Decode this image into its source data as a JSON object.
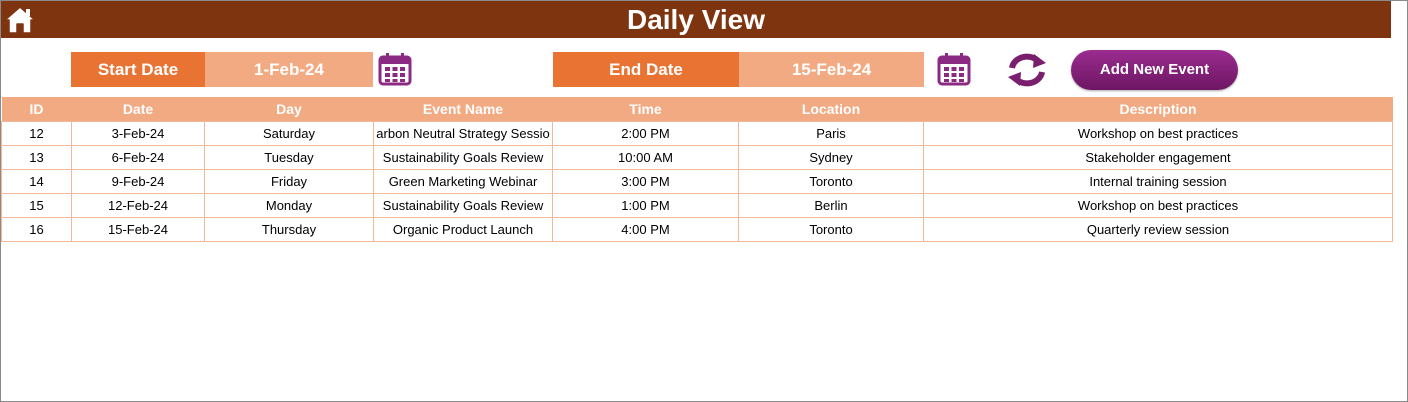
{
  "header": {
    "title": "Daily View",
    "home_icon": "home-icon"
  },
  "filters": {
    "start_label": "Start Date",
    "start_value": "1-Feb-24",
    "end_label": "End Date",
    "end_value": "15-Feb-24",
    "calendar_icon": "calendar-icon",
    "refresh_icon": "refresh-icon",
    "add_event_label": "Add New Event"
  },
  "colors": {
    "title_bar": "#7f3410",
    "label_fill": "#e87333",
    "value_fill": "#f2aa83",
    "header_fill": "#f2aa83",
    "accent_purple": "#8b2a82"
  },
  "table": {
    "columns": [
      "ID",
      "Date",
      "Day",
      "Event Name",
      "Time",
      "Location",
      "Description"
    ],
    "rows": [
      [
        "12",
        "3-Feb-24",
        "Saturday",
        "arbon Neutral Strategy Sessio",
        "2:00 PM",
        "Paris",
        "Workshop on best practices"
      ],
      [
        "13",
        "6-Feb-24",
        "Tuesday",
        "Sustainability Goals Review",
        "10:00 AM",
        "Sydney",
        "Stakeholder engagement"
      ],
      [
        "14",
        "9-Feb-24",
        "Friday",
        "Green Marketing Webinar",
        "3:00 PM",
        "Toronto",
        "Internal training session"
      ],
      [
        "15",
        "12-Feb-24",
        "Monday",
        "Sustainability Goals Review",
        "1:00 PM",
        "Berlin",
        "Workshop on best practices"
      ],
      [
        "16",
        "15-Feb-24",
        "Thursday",
        "Organic Product Launch",
        "4:00 PM",
        "Toronto",
        "Quarterly review session"
      ]
    ]
  }
}
